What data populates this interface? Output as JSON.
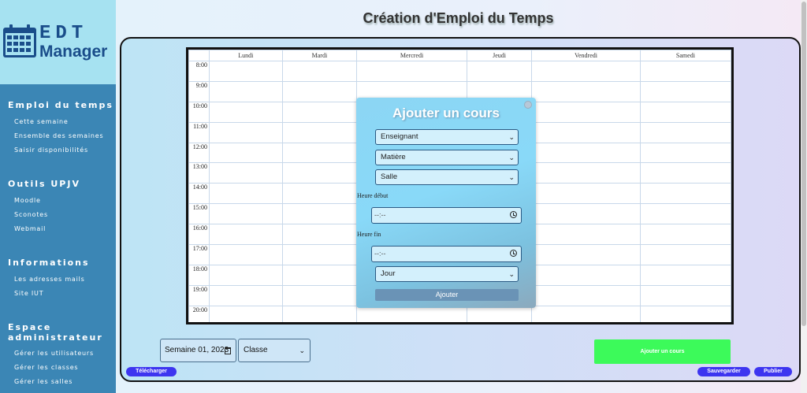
{
  "sidebar": {
    "logo": {
      "line1": "EDT",
      "line2": "Manager"
    },
    "sections": [
      {
        "title": "Emploi du temps",
        "items": [
          "Cette semaine",
          "Ensemble des semaines",
          "Saisir disponibilités"
        ]
      },
      {
        "title": "Outils UPJV",
        "items": [
          "Moodle",
          "Sconotes",
          "Webmail"
        ]
      },
      {
        "title": "Informations",
        "items": [
          "Les adresses mails",
          "Site IUT"
        ]
      },
      {
        "title": "Espace administrateur",
        "items": [
          "Gérer les utilisateurs",
          "Gérer les classes",
          "Gérer les salles"
        ]
      }
    ]
  },
  "main": {
    "title": "Création d'Emploi du Temps"
  },
  "schedule": {
    "days": [
      "Lundi",
      "Mardi",
      "Mercredi",
      "Jeudi",
      "Vendredi",
      "Samedi"
    ],
    "hours": [
      "8:00",
      "9:00",
      "10:00",
      "11:00",
      "12:00",
      "13:00",
      "14:00",
      "15:00",
      "16:00",
      "17:00",
      "18:00",
      "19:00",
      "20:00"
    ]
  },
  "modal": {
    "title": "Ajouter un cours",
    "teacher_select": "Enseignant",
    "subject_select": "Matière",
    "room_select": "Salle",
    "start_label": "Heure début",
    "start_value": "--:--",
    "end_label": "Heure fin",
    "end_value": "--:--",
    "day_select": "Jour",
    "submit_label": "Ajouter"
  },
  "controls": {
    "week_value": "Semaine 01, 2023",
    "class_select": "Classe",
    "add_course_label": "Ajouter un cours",
    "download_label": "Télécharger",
    "save_label": "Sauvegarder",
    "publish_label": "Publier"
  },
  "colors": {
    "sidebar": "#3b86b5",
    "logo_bg": "#a6e2f1",
    "add_course": "#3cfa5a",
    "pill_buttons": "#3d35f0"
  }
}
